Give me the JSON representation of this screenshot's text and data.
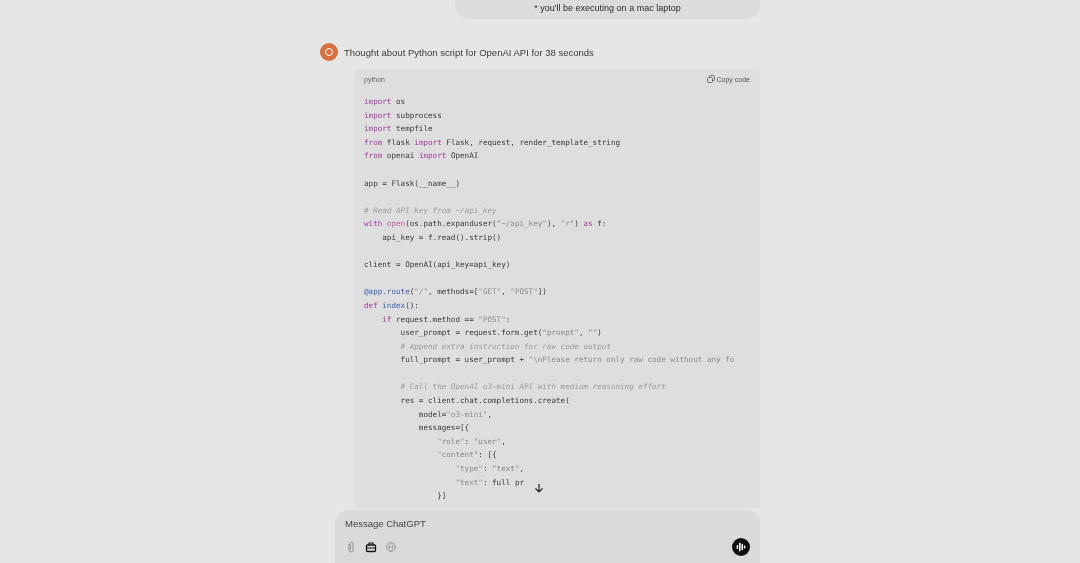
{
  "user_message": {
    "text": "* you'll be executing on a mac laptop"
  },
  "assistant": {
    "thought": "Thought about Python script for OpenAI API for 38 seconds",
    "code_block": {
      "language": "python",
      "copy_label": "Copy code",
      "lines": [
        {
          "space_before": false,
          "segments": [
            {
              "kind": "keyword",
              "text": "import"
            },
            {
              "kind": "plain",
              "text": " os"
            }
          ]
        },
        {
          "space_before": false,
          "segments": [
            {
              "kind": "keyword",
              "text": "import"
            },
            {
              "kind": "plain",
              "text": " subprocess"
            }
          ]
        },
        {
          "space_before": false,
          "segments": [
            {
              "kind": "keyword",
              "text": "import"
            },
            {
              "kind": "plain",
              "text": " tempfile"
            }
          ]
        },
        {
          "space_before": false,
          "segments": [
            {
              "kind": "keyword",
              "text": "from"
            },
            {
              "kind": "plain",
              "text": " flask "
            },
            {
              "kind": "keyword",
              "text": "import"
            },
            {
              "kind": "plain",
              "text": " Flask, request, render_template_string"
            }
          ]
        },
        {
          "space_before": false,
          "segments": [
            {
              "kind": "keyword",
              "text": "from"
            },
            {
              "kind": "plain",
              "text": " openai "
            },
            {
              "kind": "keyword",
              "text": "import"
            },
            {
              "kind": "plain",
              "text": " OpenAI"
            }
          ]
        },
        {
          "space_before": true,
          "segments": [
            {
              "kind": "plain",
              "text": "app = Flask(__name__)"
            }
          ]
        },
        {
          "space_before": true,
          "segments": [
            {
              "kind": "comment",
              "text": "# Read API key from ~/api_key"
            }
          ]
        },
        {
          "space_before": false,
          "segments": [
            {
              "kind": "keyword",
              "text": "with"
            },
            {
              "kind": "builtin",
              "text": " open"
            },
            {
              "kind": "plain",
              "text": "(os.path.expanduser("
            },
            {
              "kind": "string",
              "text": "\"~/api_key\""
            },
            {
              "kind": "plain",
              "text": "), "
            },
            {
              "kind": "string",
              "text": "\"r\""
            },
            {
              "kind": "plain",
              "text": ") "
            },
            {
              "kind": "keyword",
              "text": "as"
            },
            {
              "kind": "plain",
              "text": " f:"
            }
          ]
        },
        {
          "space_before": false,
          "segments": [
            {
              "kind": "plain",
              "text": "    api_key = f.read().strip()"
            }
          ]
        },
        {
          "space_before": true,
          "segments": [
            {
              "kind": "plain",
              "text": "client = OpenAI(api_key=api_key)"
            }
          ]
        },
        {
          "space_before": true,
          "segments": [
            {
              "kind": "decorator",
              "text": "@app.route"
            },
            {
              "kind": "plain",
              "text": "("
            },
            {
              "kind": "string",
              "text": "\"/\""
            },
            {
              "kind": "plain",
              "text": ", methods=["
            },
            {
              "kind": "string",
              "text": "\"GET\""
            },
            {
              "kind": "plain",
              "text": ", "
            },
            {
              "kind": "string",
              "text": "\"POST\""
            },
            {
              "kind": "plain",
              "text": "])"
            }
          ]
        },
        {
          "space_before": false,
          "segments": [
            {
              "kind": "keyword",
              "text": "def"
            },
            {
              "kind": "decorator",
              "text": " index"
            },
            {
              "kind": "plain",
              "text": "():"
            }
          ]
        },
        {
          "space_before": false,
          "segments": [
            {
              "kind": "keyword",
              "text": "    if"
            },
            {
              "kind": "plain",
              "text": " request.method == "
            },
            {
              "kind": "string",
              "text": "\"POST\""
            },
            {
              "kind": "plain",
              "text": ":"
            }
          ]
        },
        {
          "space_before": false,
          "segments": [
            {
              "kind": "plain",
              "text": "        user_prompt = request.form.get("
            },
            {
              "kind": "string",
              "text": "\"prompt\""
            },
            {
              "kind": "plain",
              "text": ", "
            },
            {
              "kind": "string",
              "text": "\"\""
            },
            {
              "kind": "plain",
              "text": ")"
            }
          ]
        },
        {
          "space_before": false,
          "segments": [
            {
              "kind": "comment",
              "text": "        # Append extra instruction for raw code output"
            }
          ]
        },
        {
          "space_before": false,
          "segments": [
            {
              "kind": "plain",
              "text": "        full_prompt = user_prompt + "
            },
            {
              "kind": "string",
              "text": "\"\\nPlease return only raw code without any fo"
            }
          ]
        },
        {
          "space_before": true,
          "segments": [
            {
              "kind": "comment",
              "text": "        # Call the OpenAI o3-mini API with medium reasoning effort"
            }
          ]
        },
        {
          "space_before": false,
          "segments": [
            {
              "kind": "plain",
              "text": "        res = client.chat.completions.create("
            }
          ]
        },
        {
          "space_before": false,
          "segments": [
            {
              "kind": "plain",
              "text": "            model="
            },
            {
              "kind": "string",
              "text": "\"o3-mini\""
            },
            {
              "kind": "plain",
              "text": ","
            }
          ]
        },
        {
          "space_before": false,
          "segments": [
            {
              "kind": "plain",
              "text": "            messages=[{"
            }
          ]
        },
        {
          "space_before": false,
          "segments": [
            {
              "kind": "string",
              "text": "                \"role\""
            },
            {
              "kind": "plain",
              "text": ": "
            },
            {
              "kind": "string",
              "text": "\"user\""
            },
            {
              "kind": "plain",
              "text": ","
            }
          ]
        },
        {
          "space_before": false,
          "segments": [
            {
              "kind": "string",
              "text": "                \"content\""
            },
            {
              "kind": "plain",
              "text": ": [{"
            }
          ]
        },
        {
          "space_before": false,
          "segments": [
            {
              "kind": "string",
              "text": "                    \"type\""
            },
            {
              "kind": "plain",
              "text": ": "
            },
            {
              "kind": "string",
              "text": "\"text\""
            },
            {
              "kind": "plain",
              "text": ","
            }
          ]
        },
        {
          "space_before": false,
          "segments": [
            {
              "kind": "string",
              "text": "                    \"text\""
            },
            {
              "kind": "plain",
              "text": ": full pr"
            }
          ]
        },
        {
          "space_before": false,
          "segments": [
            {
              "kind": "plain",
              "text": "                }]"
            }
          ]
        }
      ]
    }
  },
  "composer": {
    "placeholder": "Message ChatGPT"
  }
}
